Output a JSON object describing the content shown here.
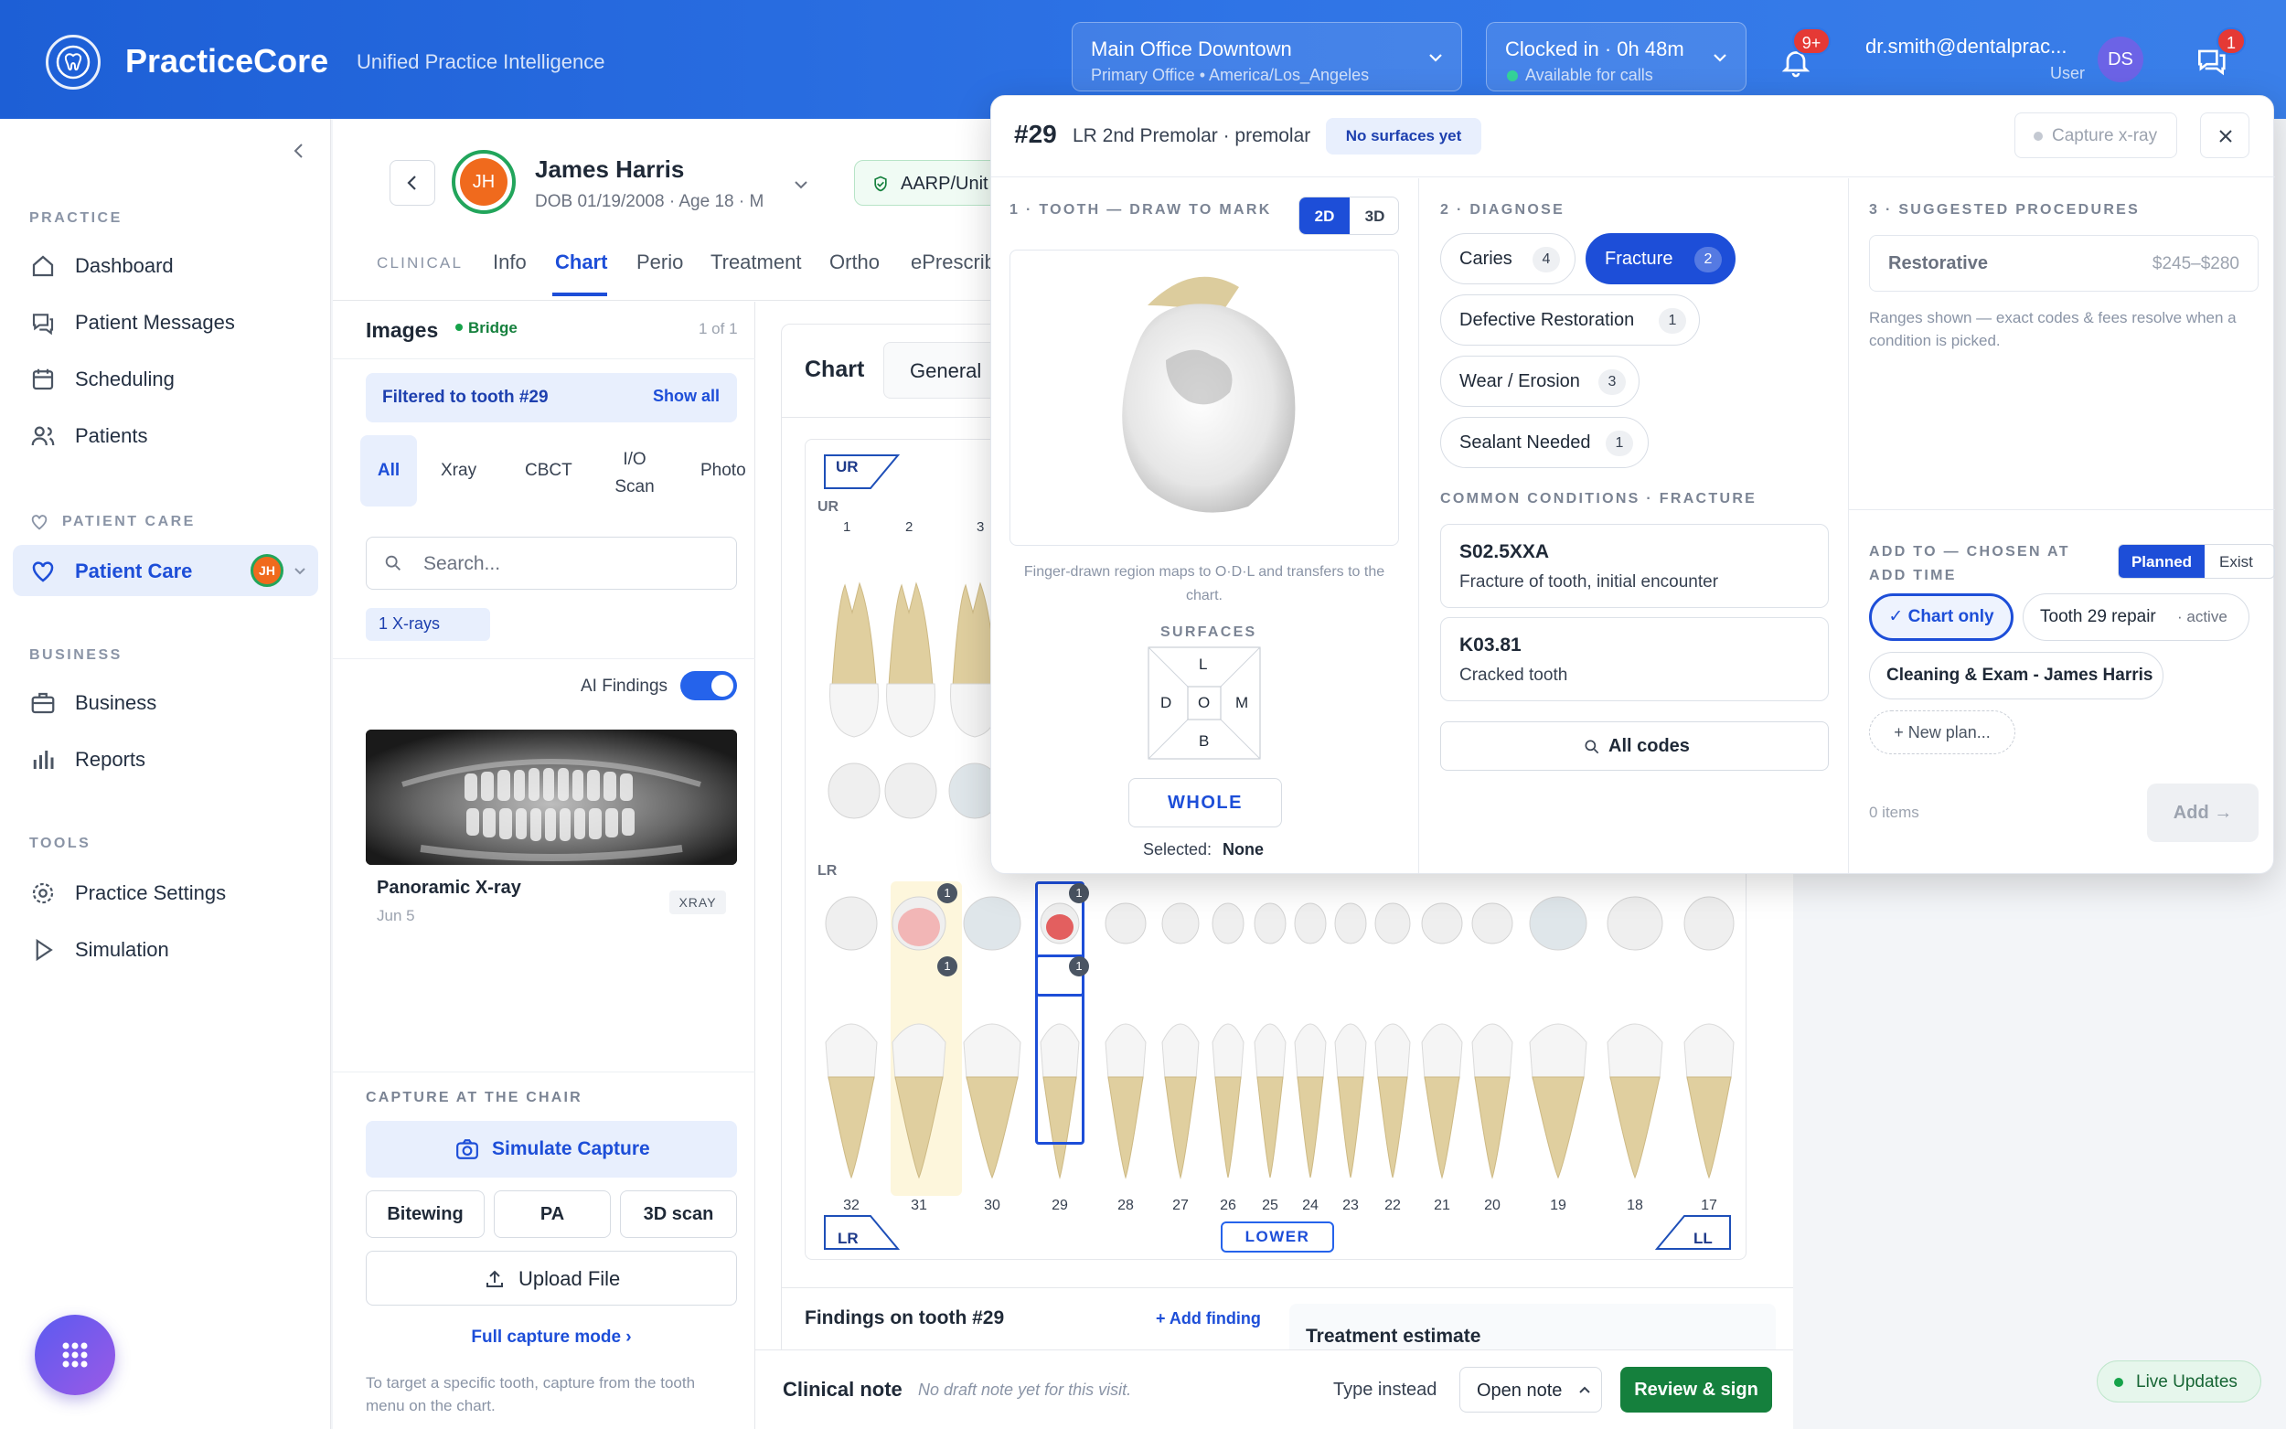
{
  "app": {
    "brand": "PracticeCore",
    "tagline": "Unified Practice Intelligence"
  },
  "header": {
    "location": {
      "title": "Main Office Downtown",
      "subtitle": "Primary Office • America/Los_Angeles"
    },
    "clock": {
      "title": "Clocked in · 0h 48m",
      "subtitle": "Available for calls"
    },
    "notif_badge": "9+",
    "chat_badge": "1",
    "user": "dr.smith@dentalprac...",
    "role": "User",
    "avatar": "DS"
  },
  "sidebar": {
    "sections": {
      "practice": "PRACTICE",
      "patient_care": "PATIENT CARE",
      "business": "BUSINESS",
      "tools": "TOOLS"
    },
    "items": [
      {
        "label": "Dashboard"
      },
      {
        "label": "Patient Messages"
      },
      {
        "label": "Scheduling"
      },
      {
        "label": "Patients"
      },
      {
        "label": "Patient Care",
        "badge": "JH"
      },
      {
        "label": "Business"
      },
      {
        "label": "Reports"
      },
      {
        "label": "Practice Settings"
      },
      {
        "label": "Simulation"
      }
    ]
  },
  "patient": {
    "name": "James Harris",
    "initials": "JH",
    "meta": "DOB 01/19/2008 · Age 18 · M",
    "insurance": "AARP/Unit"
  },
  "tabs": {
    "section": "CLINICAL",
    "items": [
      "Info",
      "Chart",
      "Perio",
      "Treatment",
      "Ortho",
      "ePrescrib"
    ],
    "active": "Chart"
  },
  "images": {
    "title": "Images",
    "bridge": "Bridge",
    "count": "1 of 1",
    "filter": "Filtered to tooth #29",
    "show_all": "Show all",
    "types": [
      "All",
      "Xray",
      "CBCT",
      "I/O Scan",
      "Photo"
    ],
    "search_placeholder": "Search...",
    "xray_chip": "1 X-rays",
    "ai_findings": "AI Findings",
    "card": {
      "title": "Panoramic X-ray",
      "date": "Jun 5",
      "tag": "XRAY"
    },
    "capture_title": "CAPTURE AT THE CHAIR",
    "simulate": "Simulate Capture",
    "modes": [
      "Bitewing",
      "PA",
      "3D scan"
    ],
    "upload": "Upload File",
    "full_mode": "Full capture mode ›",
    "hint": "To target a specific tooth, capture from the tooth menu on the chart."
  },
  "chart": {
    "title": "Chart",
    "view": "General",
    "q_ur": "UR",
    "q_lr": "LR",
    "q_ll": "LL",
    "lower": "LOWER",
    "upper_nums": [
      "1",
      "2",
      "3"
    ],
    "lower_nums": [
      "32",
      "31",
      "30",
      "29",
      "28",
      "27",
      "26",
      "25",
      "24",
      "23",
      "22",
      "21",
      "20",
      "19",
      "18",
      "17"
    ],
    "findings": "Findings on tooth #29",
    "add_finding": "+ Add finding",
    "estimate": "Treatment estimate",
    "note_title": "Clinical note",
    "note_placeholder": "No draft note yet for this visit.",
    "type_instead": "Type instead",
    "open_note": "Open note",
    "review": "Review & sign",
    "live": "Live Updates"
  },
  "popover": {
    "tooth": "#29",
    "desc": "LR 2nd Premolar · premolar",
    "surf_badge": "No surfaces yet",
    "capture": "Capture x-ray",
    "step1": "1 · TOOTH — DRAW TO MARK",
    "dims": [
      "2D",
      "3D"
    ],
    "draw_hint": "Finger-drawn region maps to O·D·L and transfers to the chart.",
    "surfaces_label": "SURFACES",
    "surfaces": {
      "l": "L",
      "d": "D",
      "o": "O",
      "m": "M",
      "b": "B"
    },
    "whole": "WHOLE",
    "selected_label": "Selected:",
    "selected": "None",
    "step2": "2 · DIAGNOSE",
    "diagnoses": [
      {
        "label": "Caries",
        "count": "4"
      },
      {
        "label": "Fracture",
        "count": "2"
      },
      {
        "label": "Defective Restoration",
        "count": "1"
      },
      {
        "label": "Wear / Erosion",
        "count": "3"
      },
      {
        "label": "Sealant Needed",
        "count": "1"
      }
    ],
    "common": "COMMON CONDITIONS · FRACTURE",
    "codes": [
      {
        "code": "S02.5XXA",
        "desc": "Fracture of tooth, initial encounter"
      },
      {
        "code": "K03.81",
        "desc": "Cracked tooth"
      }
    ],
    "all_codes": "All codes",
    "step3": "3 · SUGGESTED PROCEDURES",
    "proc": {
      "name": "Restorative",
      "range": "$245–$280"
    },
    "proc_hint": "Ranges shown — exact codes & fees resolve when a condition is picked.",
    "add_to": "ADD TO — CHOSEN AT ADD TIME",
    "modes": [
      "Planned",
      "Exist"
    ],
    "targets": [
      "✓ Chart only",
      "Tooth 29 repair",
      "Cleaning & Exam - James Harris",
      "+ New plan..."
    ],
    "active_tag": "· active",
    "items": "0 items",
    "add": "Add →"
  },
  "colors": {
    "primary": "#1d5fd6",
    "accent": "#2563eb",
    "success": "#16a34a",
    "danger": "#e53935"
  }
}
